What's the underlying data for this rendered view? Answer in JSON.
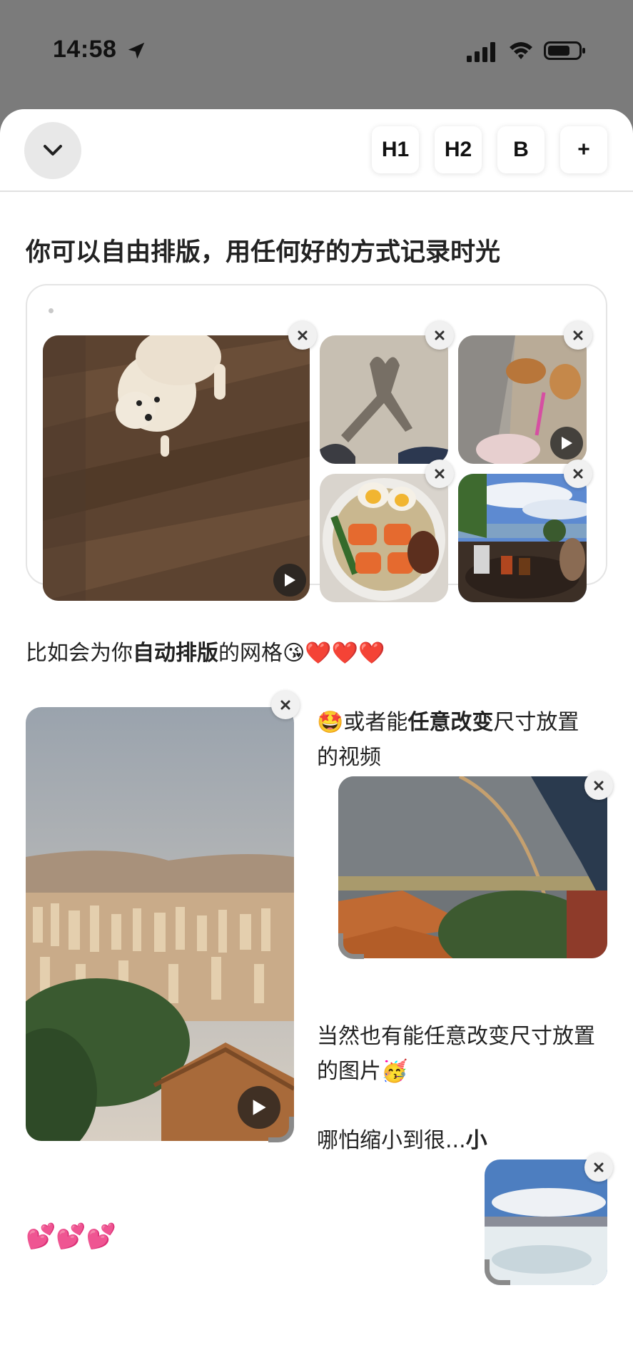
{
  "status": {
    "time": "14:58"
  },
  "toolbar": {
    "h1_label": "H1",
    "h2_label": "H2",
    "bold_label": "B",
    "add_label": "+"
  },
  "content": {
    "heading": "你可以自由排版，用任何好的方式记录时光",
    "grid_caption_prefix": "比如会为你",
    "grid_caption_bold": "自动排版",
    "grid_caption_suffix": "的网格",
    "grid_caption_emoji": "😘❤️❤️❤️",
    "video_caption_emoji": "🤩",
    "video_caption_prefix": "或者能",
    "video_caption_bold": "任意改变",
    "video_caption_suffix": "尺寸放置",
    "video_caption_line2": "的视频",
    "image_caption_line1": "当然也有能任意改变尺寸放置",
    "image_caption_line2": "的图片",
    "image_caption_emoji": "🥳",
    "small_caption_prefix": "哪怕缩小到很...",
    "small_caption_bold": "小",
    "hearts": "💕💕💕"
  },
  "icons": {
    "collapse": "chevron-down-icon",
    "close": "close-icon",
    "play": "play-icon"
  },
  "colors": {
    "text": "#222222",
    "sheet_bg": "#ffffff",
    "backdrop": "#7b7b7b"
  }
}
